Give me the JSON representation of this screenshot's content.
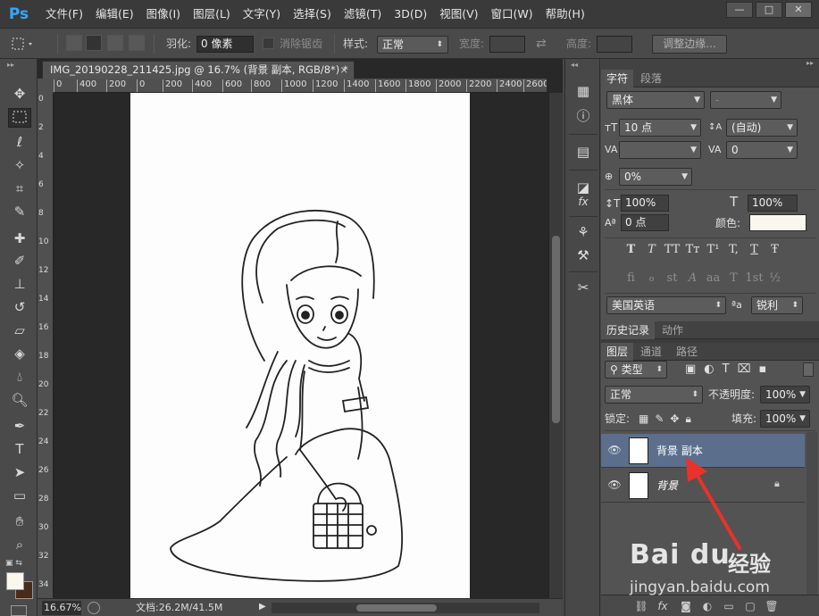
{
  "app": {
    "logo": "Ps"
  },
  "menu": [
    "文件(F)",
    "编辑(E)",
    "图像(I)",
    "图层(L)",
    "文字(Y)",
    "选择(S)",
    "滤镜(T)",
    "3D(D)",
    "视图(V)",
    "窗口(W)",
    "帮助(H)"
  ],
  "window_controls": {
    "minimize": "—",
    "maximize": "□",
    "close": "✕"
  },
  "options": {
    "feather_label": "羽化:",
    "feather_value": "0 像素",
    "antialias_label": "消除锯齿",
    "style_label": "样式:",
    "style_value": "正常",
    "width_label": "宽度:",
    "height_label": "高度:",
    "refine_edge": "调整边缘..."
  },
  "document": {
    "tab_title": "IMG_20190228_211425.jpg @ 16.7% (背景 副本, RGB/8*) *",
    "close": "×",
    "ruler_top": [
      "0",
      "400",
      "200",
      "0",
      "200",
      "400",
      "600",
      "800",
      "1000",
      "1200",
      "1400",
      "1600",
      "1800",
      "2000",
      "2200",
      "2400",
      "2600"
    ],
    "ruler_left": [
      "0",
      "2",
      "4",
      "6",
      "8",
      "10",
      "12",
      "14",
      "16",
      "18",
      "20",
      "22",
      "24",
      "26",
      "28",
      "30",
      "32",
      "34"
    ],
    "zoom": "16.67%",
    "doc_info": "文档:26.2M/41.5M"
  },
  "tools": [
    "move",
    "marquee",
    "lasso",
    "magic-wand",
    "crop",
    "eyedropper",
    "healing",
    "brush",
    "stamp",
    "history-brush",
    "eraser",
    "bucket",
    "blur",
    "dodge",
    "pen",
    "type",
    "path-select",
    "shape",
    "hand",
    "zoom"
  ],
  "character_panel": {
    "tabs": [
      "字符",
      "段落"
    ],
    "font_family": "黑体",
    "font_style": "-",
    "font_size": "10 点",
    "leading": "(自动)",
    "kerning": "",
    "tracking": "0",
    "scale_percent": "0%",
    "vertical_scale": "100%",
    "horizontal_scale": "100%",
    "baseline_shift": "0 点",
    "color_label": "颜色:",
    "color": "#fcf7ee",
    "style_glyphs": [
      "T",
      "T",
      "TT",
      "Tт",
      "T¹",
      "T,",
      "T",
      "Ŧ"
    ],
    "opentype_glyphs": [
      "fi",
      "ℴ",
      "st",
      "A",
      "aa",
      "T",
      "1st",
      "½"
    ],
    "language": "美国英语",
    "aa_label": "ªa",
    "antialias": "锐利"
  },
  "history_panel": {
    "tabs": [
      "历史记录",
      "动作"
    ]
  },
  "layers_panel": {
    "tabs": [
      "图层",
      "通道",
      "路径"
    ],
    "filter_label": "类型",
    "blend_mode": "正常",
    "opacity_label": "不透明度:",
    "opacity": "100%",
    "lock_label": "锁定:",
    "fill_label": "填充:",
    "fill": "100%",
    "layers": [
      {
        "name": "背景 副本",
        "selected": true
      },
      {
        "name": "背景",
        "selected": false,
        "locked": true
      }
    ]
  },
  "watermark": {
    "logo": "Bai du",
    "text": "经验",
    "url": "jingyan.baidu.com"
  }
}
